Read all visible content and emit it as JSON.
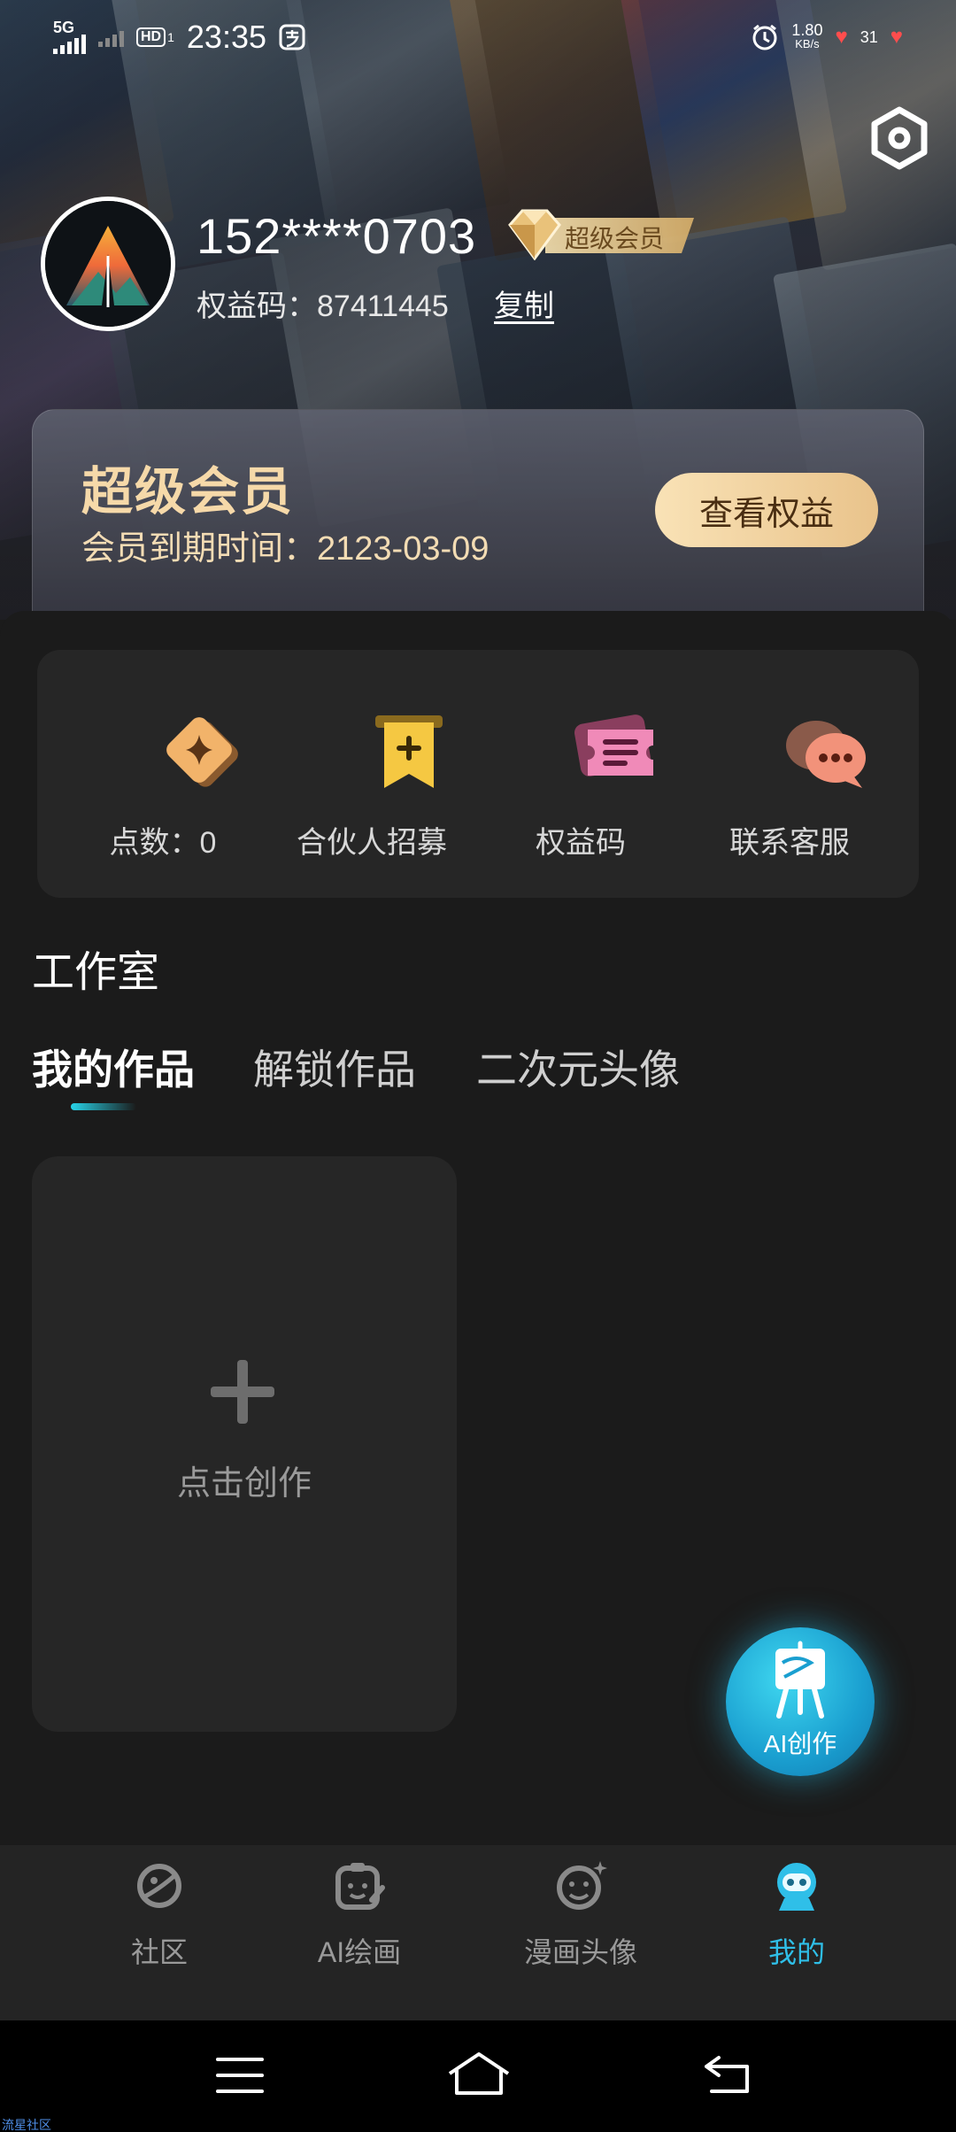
{
  "status_bar": {
    "network": "5G",
    "hd_label": "HD",
    "hd_sub": "1",
    "time": "23:35",
    "speed_value": "1.80",
    "speed_unit": "KB/s",
    "battery": "31"
  },
  "profile": {
    "phone": "152****0703",
    "vip_label": "超级会员",
    "code_label": "权益码：87411445",
    "copy_label": "复制"
  },
  "member_card": {
    "title": "超级会员",
    "expire_text": "会员到期时间：2123-03-09",
    "benefit_button": "查看权益"
  },
  "quick_actions": [
    {
      "label": "点数：0",
      "icon": "sparkle-star-icon"
    },
    {
      "label": "合伙人招募",
      "icon": "bookmark-plus-icon"
    },
    {
      "label": "权益码",
      "icon": "ticket-icon"
    },
    {
      "label": "联系客服",
      "icon": "chat-bubbles-icon"
    }
  ],
  "studio": {
    "title": "工作室",
    "tabs": [
      "我的作品",
      "解锁作品",
      "二次元头像"
    ],
    "active_tab": 0,
    "create_label": "点击创作"
  },
  "fab": {
    "label": "AI创作",
    "icon": "easel-icon"
  },
  "bottom_nav": [
    {
      "label": "社区",
      "icon": "planet-icon",
      "active": false
    },
    {
      "label": "AI绘画",
      "icon": "palette-face-icon",
      "active": false
    },
    {
      "label": "漫画头像",
      "icon": "smiley-sparkle-icon",
      "active": false
    },
    {
      "label": "我的",
      "icon": "robot-avatar-icon",
      "active": true
    }
  ],
  "colors": {
    "accent": "#2fbfe8",
    "gold": "#f6d9a9",
    "background": "#1b1b1b",
    "card": "#262626"
  },
  "watermark": "流星社区"
}
